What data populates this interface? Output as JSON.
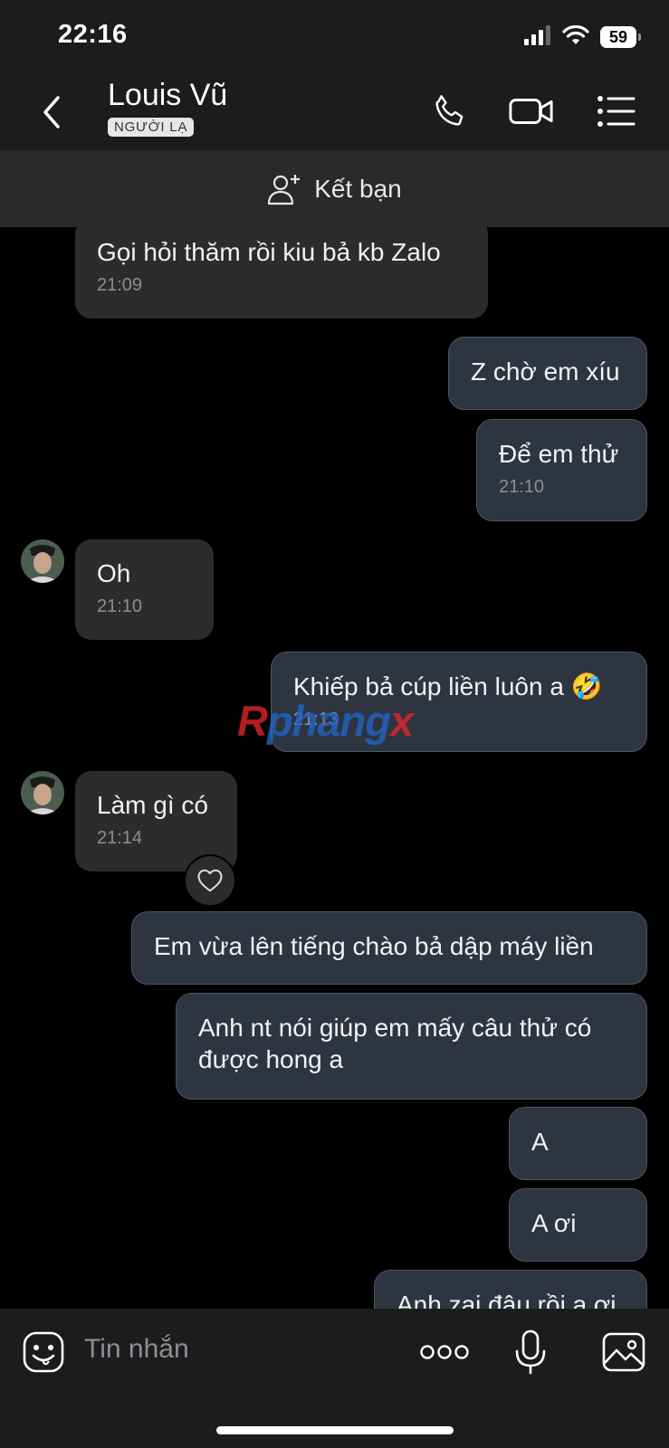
{
  "status_bar": {
    "time": "22:16",
    "battery": "59"
  },
  "header": {
    "contact_name": "Louis Vũ",
    "badge": "NGƯỜI LẠ"
  },
  "friend_bar": {
    "label": "Kết bạn"
  },
  "messages": [
    {
      "side": "in",
      "text": "Gọi hỏi thăm rồi kiu bả kb Zalo",
      "time": "21:09"
    },
    {
      "side": "out",
      "text": "Z chờ em xíu",
      "time": ""
    },
    {
      "side": "out",
      "text": "Để em thử",
      "time": "21:10"
    },
    {
      "side": "in",
      "text": "Oh",
      "time": "21:10"
    },
    {
      "side": "out",
      "text": "Khiếp bả cúp liền luôn a 🤣",
      "time": "21:13"
    },
    {
      "side": "in",
      "text": "Làm gì có",
      "time": "21:14"
    },
    {
      "side": "out",
      "text": "Em vừa lên tiếng chào bả dập máy liền",
      "time": ""
    },
    {
      "side": "out",
      "text": "Anh nt nói giúp em mấy câu thử có được hong a",
      "time": ""
    },
    {
      "side": "out",
      "text": "A",
      "time": ""
    },
    {
      "side": "out",
      "text": "A ơi",
      "time": ""
    },
    {
      "side": "out",
      "text": "Anh zai đâu rồi a ơi",
      "time": ""
    }
  ],
  "watermark": {
    "part1": "R",
    "part2": "phang",
    "part3": "x"
  },
  "input": {
    "placeholder": "Tin nhắn"
  },
  "colors": {
    "incoming_bubble": "#2c2c2e",
    "outgoing_bubble": "#2e3541",
    "outgoing_border": "#4a5566",
    "time_text": "#8e8e93"
  }
}
